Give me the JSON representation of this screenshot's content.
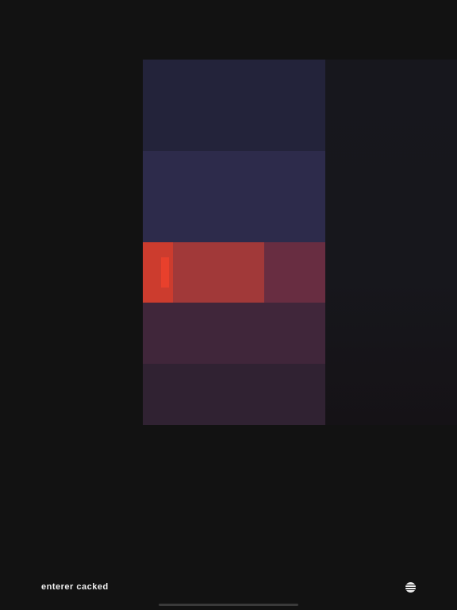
{
  "footer": {
    "status_label": "enterer cacked",
    "menu_icon": "striped-circle-icon"
  },
  "colors": {
    "background": "#121212",
    "band_1": "#23233a",
    "band_2": "#2d2b4b",
    "band_3": "#682d41",
    "band_4": "#40263a",
    "band_5": "#302232",
    "active_segment": "#cc3c2e",
    "selected_segment": "#a13939",
    "cursor": "#e8402c"
  }
}
